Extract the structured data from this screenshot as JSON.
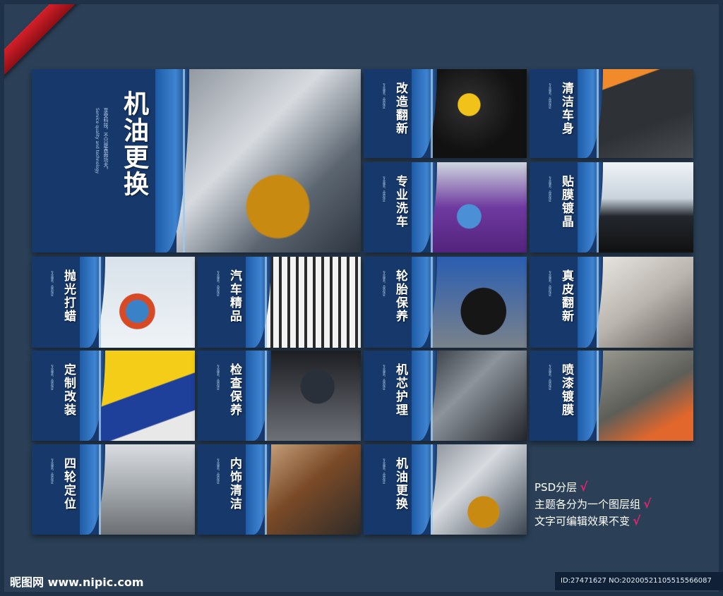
{
  "panels": [
    {
      "id": "oil-change-large",
      "title": "机油更换",
      "subtitle": "享受科技，不只是表面功夫。",
      "en": "Service quality and technology",
      "photo": "oil-pour-photo"
    },
    {
      "id": "remodel",
      "title": "改造翻新",
      "subtitle": "专业服务，品质保证",
      "photo": "polishing-photo"
    },
    {
      "id": "car-cleaning",
      "title": "清洁车身",
      "subtitle": "专业服务，品质保证",
      "photo": "dashboard-cleaning-photo"
    },
    {
      "id": "pro-wash",
      "title": "专业洗车",
      "subtitle": "专业服务，品质保证",
      "photo": "car-wash-photo"
    },
    {
      "id": "film-coating",
      "title": "贴膜镀晶",
      "subtitle": "专业服务，品质保证",
      "photo": "film-application-photo"
    },
    {
      "id": "polish-wax",
      "title": "抛光打蜡",
      "subtitle": "专业服务，品质保证",
      "photo": "polisher-photo"
    },
    {
      "id": "car-products",
      "title": "汽车精品",
      "subtitle": "专业服务，品质保证",
      "photo": "shop-shelf-photo"
    },
    {
      "id": "tire-care",
      "title": "轮胎保养",
      "subtitle": "专业服务，品质保证",
      "photo": "tire-photo"
    },
    {
      "id": "leather-renew",
      "title": "真皮翻新",
      "subtitle": "专业服务，品质保证",
      "photo": "leather-seat-photo"
    },
    {
      "id": "custom-mod",
      "title": "定制改装",
      "subtitle": "专业服务，品质保证",
      "photo": "race-car-photo"
    },
    {
      "id": "inspection",
      "title": "检查保养",
      "subtitle": "专业服务，品质保证",
      "photo": "laptop-diagnosis-photo"
    },
    {
      "id": "engine-care",
      "title": "机芯护理",
      "subtitle": "专业服务，品质保证",
      "photo": "engine-bay-photo"
    },
    {
      "id": "spray-coating",
      "title": "喷漆镀膜",
      "subtitle": "专业服务，品质保证",
      "photo": "spray-painting-photo"
    },
    {
      "id": "wheel-align",
      "title": "四轮定位",
      "subtitle": "专业服务，品质保证",
      "photo": "garage-lift-photo"
    },
    {
      "id": "interior-clean",
      "title": "内饰清洁",
      "subtitle": "专业服务，品质保证",
      "photo": "car-interior-photo"
    },
    {
      "id": "oil-change-small",
      "title": "机油更换",
      "subtitle": "专业服务，品质保证",
      "photo": "oil-pour-photo"
    }
  ],
  "notes": [
    "PSD分层",
    "主题各分为一个图层组",
    "文字可编辑效果不变"
  ],
  "check_mark": "√",
  "logo": "昵图网 www.nipic.com",
  "image_id": "ID:27471627 NO:20200521105515566087",
  "colors": {
    "panel": "#16386b",
    "accent": "#3e84d1",
    "check": "#e0246e",
    "background": "#2b4057"
  }
}
